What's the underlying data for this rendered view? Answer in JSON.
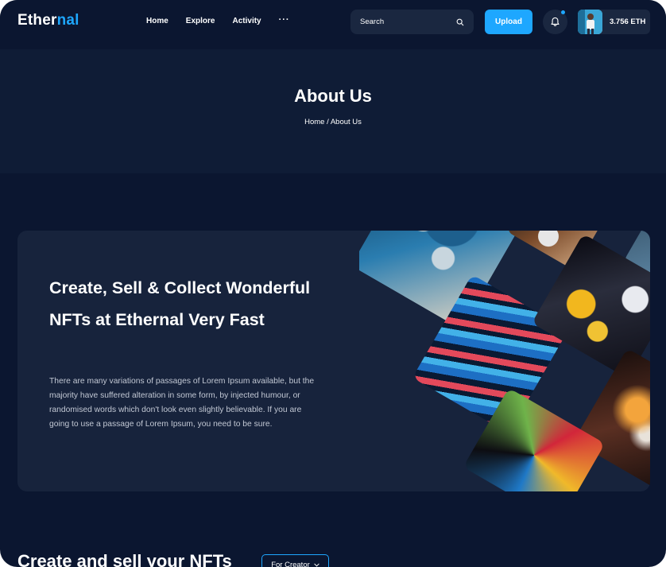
{
  "brand": {
    "name_part1": "Ether",
    "name_part2": "nal",
    "accent": "#1ea7ff"
  },
  "nav": {
    "items": [
      {
        "label": "Home"
      },
      {
        "label": "Explore"
      },
      {
        "label": "Activity"
      },
      {
        "label": "···"
      }
    ],
    "search_placeholder": "Search",
    "search_icon": "search-icon",
    "upload_label": "Upload",
    "notification_icon": "bell-icon",
    "balance": "3.756 ETH"
  },
  "page_header": {
    "title": "About Us",
    "breadcrumb": "Home / About Us"
  },
  "intro": {
    "heading": "Create, Sell & Collect Wonderful NFTs at Ethernal Very Fast",
    "body": "There are many variations of passages of Lorem Ipsum available, but the majority have suffered alteration in some form, by injected humour, or randomised words which don't look even slightly believable. If you are going to use a passage of Lorem Ipsum, you need to be sure."
  },
  "section": {
    "title": "Create and sell your NFTs",
    "filter_label": "For Creator"
  },
  "colors": {
    "background": "#0b1630",
    "card": "#17233c",
    "band": "#0f1c36"
  }
}
